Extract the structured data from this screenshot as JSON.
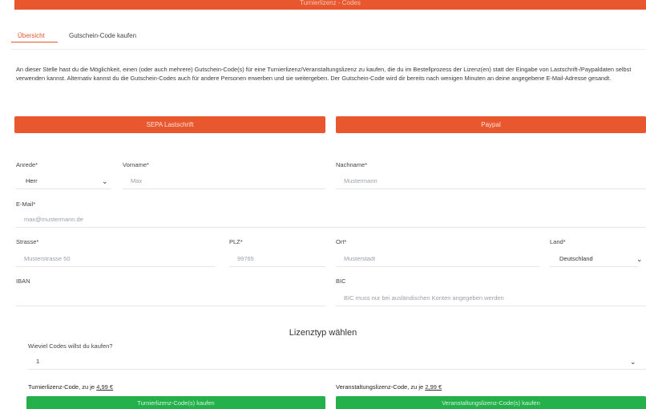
{
  "header": {
    "title": "Turnierlizenz - Codes"
  },
  "tabs": [
    {
      "label": "Übersicht",
      "active": true
    },
    {
      "label": "Gutschein-Code kaufen",
      "active": false
    }
  ],
  "intro_text": "An dieser Stelle hast du die Möglichkeit, einen (oder auch mehrere) Gutschein-Code(s) für eine Turnierlizenz/Veranstaltungslizenz zu kaufen, die du im Bestellprozess der Lizenz(en) statt der Eingabe von Lastschrift-/Paypaldaten selbst verwenden kannst. Alternativ kannst du die Gutschein-Codes auch für andere Personen erwerben und sie weitergeben. Der Gutschein-Code wird dir bereits nach wenigen Minuten an deine angegebene E-Mail-Adresse gesandt.",
  "payment": {
    "sepa_label": "SEPA Lastschrift",
    "paypal_label": "Paypal"
  },
  "form": {
    "anrede": {
      "label": "Anrede*",
      "value": "Herr"
    },
    "vorname": {
      "label": "Vorname*",
      "placeholder": "Max"
    },
    "nachname": {
      "label": "Nachname*",
      "placeholder": "Mustermann"
    },
    "email": {
      "label": "E-Mail*",
      "placeholder": "max@mustermann.de"
    },
    "strasse": {
      "label": "Strasse*",
      "placeholder": "Musterstrasse 50"
    },
    "plz": {
      "label": "PLZ*",
      "placeholder": "99765"
    },
    "ort": {
      "label": "Ort*",
      "placeholder": "Musterstadt"
    },
    "land": {
      "label": "Land*",
      "value": "Deutschland"
    },
    "iban": {
      "label": "IBAN",
      "placeholder": ""
    },
    "bic": {
      "label": "BIC",
      "placeholder": "BIC muss nur bei ausländischen Konten angegeben werden"
    }
  },
  "license": {
    "section_title": "Lizenztyp wählen",
    "quantity_label": "Wieviel Codes willst du kaufen?",
    "quantity_value": "1",
    "turnier_label": "Turnierlizenz-Code, zu je",
    "turnier_price": "4,99 €",
    "turnier_button": "Turnierlizenz-Code(s) kaufen",
    "veranstaltung_label": "Veranstaltungslizenz-Code, zu je",
    "veranstaltung_price": "2,99 €",
    "veranstaltung_button": "Veranstaltungslizenz-Code(s) kaufen"
  },
  "colors": {
    "accent": "#e8572d",
    "success": "#24b04b"
  }
}
